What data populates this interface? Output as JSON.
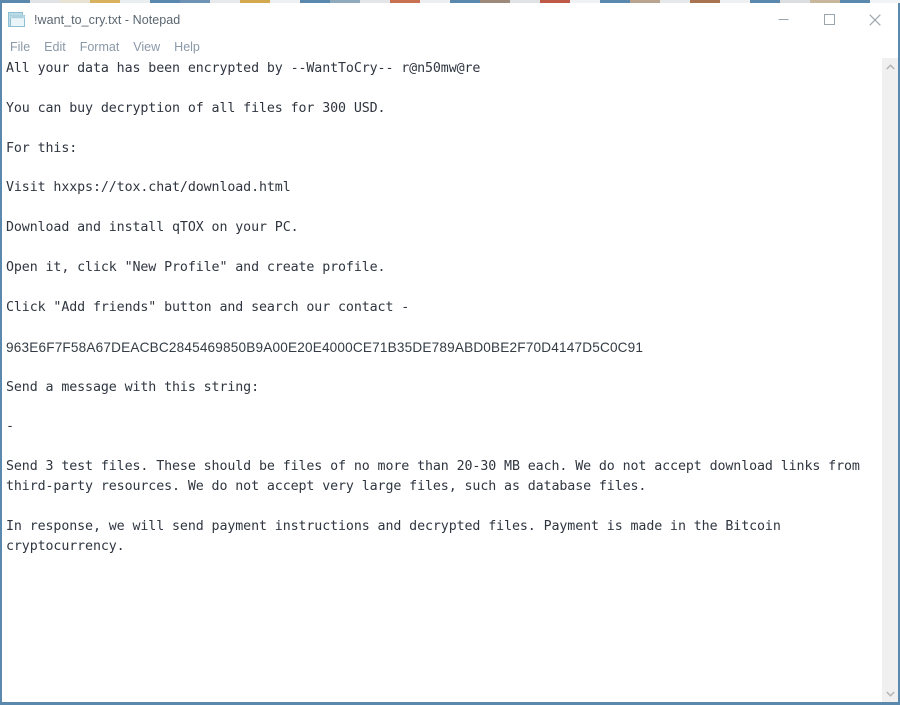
{
  "window": {
    "title": "!want_to_cry.txt - Notepad",
    "app_icon": "notepad-icon",
    "border_color": "#5b88ad",
    "background": "#ffffff"
  },
  "caption_buttons": [
    {
      "name": "minimize-button",
      "glyph": "minimize-icon",
      "label": "Minimize"
    },
    {
      "name": "maximize-button",
      "glyph": "maximize-icon",
      "label": "Maximize"
    },
    {
      "name": "close-button",
      "glyph": "close-icon",
      "label": "Close"
    }
  ],
  "menubar": {
    "items": [
      {
        "label": "File"
      },
      {
        "label": "Edit"
      },
      {
        "label": "Format"
      },
      {
        "label": "View"
      },
      {
        "label": "Help"
      }
    ],
    "text_color": "#8a99a8"
  },
  "document": {
    "text_color": "#2f3640",
    "lines": [
      {
        "text": "All your data has been encrypted by --WantToCry-- r@n50mw@re",
        "style": "mono"
      },
      {
        "text": "",
        "style": "blank"
      },
      {
        "text": "You can buy decryption of all files for 300 USD.",
        "style": "mono"
      },
      {
        "text": "",
        "style": "blank"
      },
      {
        "text": "For this:",
        "style": "mono"
      },
      {
        "text": "",
        "style": "blank"
      },
      {
        "text": "Visit hxxps://tox.chat/download.html",
        "style": "mono"
      },
      {
        "text": "",
        "style": "blank"
      },
      {
        "text": "Download and install qTOX on your PC.",
        "style": "mono"
      },
      {
        "text": "",
        "style": "blank"
      },
      {
        "text": "Open it, click \"New Profile\" and create profile.",
        "style": "mono"
      },
      {
        "text": "",
        "style": "blank"
      },
      {
        "text": "Click \"Add friends\" button and search our contact -",
        "style": "mono"
      },
      {
        "text": "",
        "style": "blank"
      },
      {
        "text": "963E6F7F58A67DEACBC2845469850B9A00E20E4000CE71B35DE789ABD0BE2F70D4147D5C0C91",
        "style": "hex"
      },
      {
        "text": "",
        "style": "blank"
      },
      {
        "text": "Send a message with this string:",
        "style": "mono"
      },
      {
        "text": "",
        "style": "blank"
      },
      {
        "text": "-",
        "style": "mono"
      },
      {
        "text": "",
        "style": "blank"
      },
      {
        "text": "Send 3 test files. These should be files of no more than 20-30 MB each. We do not accept download links from third-party resources. We do not accept very large files, such as database files.",
        "style": "wrapped"
      },
      {
        "text": "",
        "style": "blank"
      },
      {
        "text": "In response, we will send payment instructions and decrypted files. Payment is made in the Bitcoin cryptocurrency.",
        "style": "wrapped"
      }
    ]
  },
  "scrollbar": {
    "up_arrow": "chevron-up-icon",
    "down_arrow": "chevron-down-icon",
    "track_color": "#f0f0f0"
  },
  "desktop_strip": {
    "segments": [
      "#5b88ad",
      "#dfe3e6",
      "#e8e2d2",
      "#d9b25f",
      "#e9eef1",
      "#5b88ad",
      "#6e93b4",
      "#e7e9ea",
      "#d2a94f",
      "#edeff0",
      "#5b88ad",
      "#8fa9bd",
      "#e3e5e6",
      "#c8704f",
      "#eceeef",
      "#5b88ad",
      "#9d8a7a",
      "#e0e2e3",
      "#c05a48",
      "#f0f1f2",
      "#5b88ad",
      "#b9a58f",
      "#e6e8e9",
      "#a8744f",
      "#eef0f1",
      "#5b88ad",
      "#dadedf",
      "#c9b79d",
      "#5b88ad",
      "#f2f3f4"
    ]
  }
}
